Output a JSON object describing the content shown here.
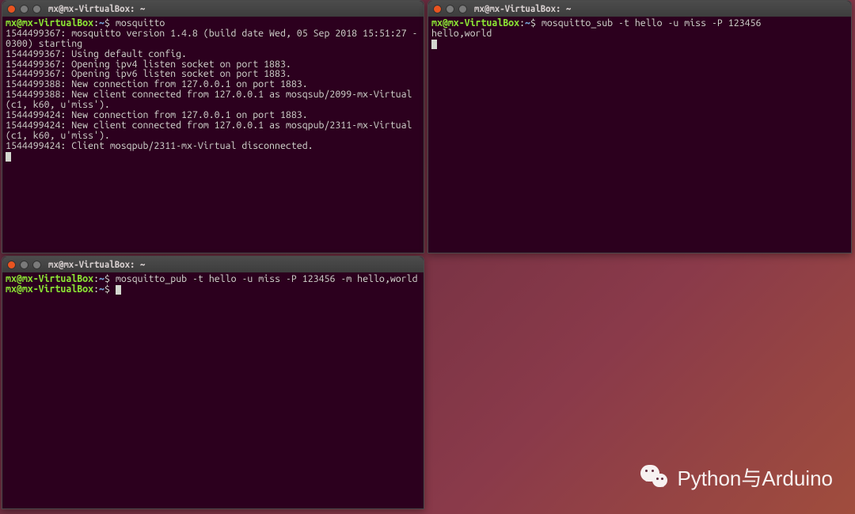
{
  "terminals": {
    "top_left": {
      "title": "mx@mx-VirtualBox: ~",
      "user": "mx",
      "host": "mx-VirtualBox",
      "path": "~",
      "sep": "$",
      "command": "mosquitto",
      "output_lines": [
        "1544499367: mosquitto version 1.4.8 (build date Wed, 05 Sep 2018 15:51:27 -0300) starting",
        "1544499367: Using default config.",
        "1544499367: Opening ipv4 listen socket on port 1883.",
        "1544499367: Opening ipv6 listen socket on port 1883.",
        "1544499388: New connection from 127.0.0.1 on port 1883.",
        "1544499388: New client connected from 127.0.0.1 as mosqsub/2099-mx-Virtual (c1, k60, u'miss').",
        "1544499424: New connection from 127.0.0.1 on port 1883.",
        "1544499424: New client connected from 127.0.0.1 as mosqpub/2311-mx-Virtual (c1, k60, u'miss').",
        "1544499424: Client mosqpub/2311-mx-Virtual disconnected."
      ]
    },
    "top_right": {
      "title": "mx@mx-VirtualBox: ~",
      "user": "mx",
      "host": "mx-VirtualBox",
      "path": "~",
      "sep": "$",
      "command": "mosquitto_sub -t hello -u miss -P 123456",
      "output_lines": [
        "hello,world"
      ]
    },
    "bottom_left": {
      "title": "mx@mx-VirtualBox: ~",
      "user": "mx",
      "host": "mx-VirtualBox",
      "path": "~",
      "sep": "$",
      "command": "mosquitto_pub -t hello -u miss -P 123456 -m hello,world",
      "second_prompt": true
    }
  },
  "watermark": "Python与Arduino"
}
